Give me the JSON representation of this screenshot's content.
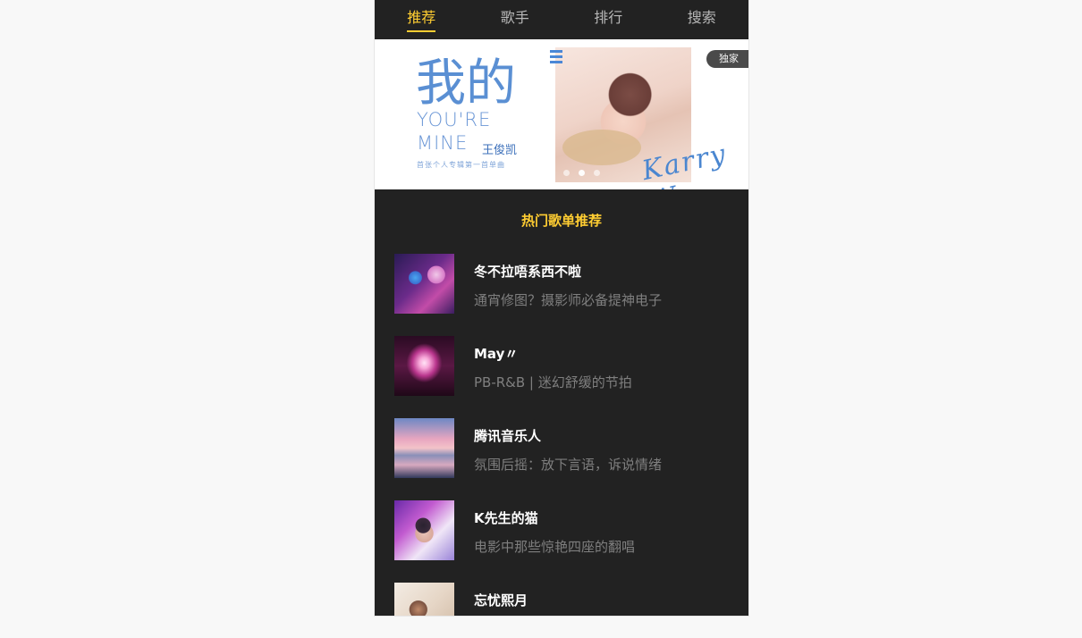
{
  "tabs": [
    {
      "label": "推荐",
      "active": true
    },
    {
      "label": "歌手",
      "active": false
    },
    {
      "label": "排行",
      "active": false
    },
    {
      "label": "搜索",
      "active": false
    }
  ],
  "banner": {
    "title_zh": "我的",
    "title_en_line1": "YOU'RE",
    "title_en_line2": "MINE",
    "artist": "王俊凯",
    "subtitle": "首张个人专辑第一首单曲",
    "signature": "Karry W.",
    "badge": "独家",
    "dots_count": 3,
    "active_dot": 1
  },
  "hot_section": {
    "title": "热门歌单推荐",
    "items": [
      {
        "name": "冬不拉唔系西不啦",
        "desc": "通宵修图？摄影师必备提神电子"
      },
      {
        "name": "May〃",
        "desc": "PB-R&B | 迷幻舒缓的节拍"
      },
      {
        "name": "腾讯音乐人",
        "desc": "氛围后摇：放下言语，诉说情绪"
      },
      {
        "name": "K先生的猫",
        "desc": "电影中那些惊艳四座的翻唱"
      },
      {
        "name": "忘忧熙月",
        "desc": ""
      }
    ]
  },
  "colors": {
    "accent": "#ffcd32",
    "background": "#222222",
    "text_primary": "#ffffff",
    "text_secondary": "#7f7f7f",
    "tab_inactive": "#b7b7b7",
    "page_background": "#f8f8f8"
  },
  "icons": {
    "banner_menu": "menu-icon"
  }
}
